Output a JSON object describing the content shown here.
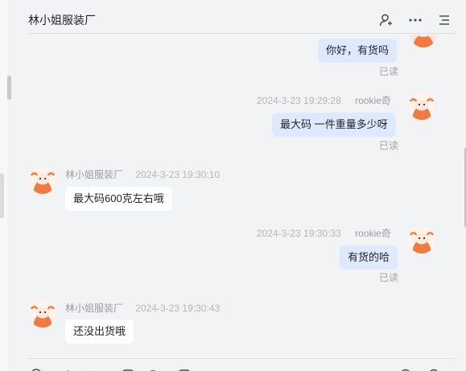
{
  "header": {
    "title": "林小姐服装厂",
    "icons": [
      "add-user-icon",
      "more-icon",
      "menu-icon"
    ]
  },
  "messages": [
    {
      "side": "me",
      "text": "你好，有货吗",
      "status": "已读"
    },
    {
      "side": "me",
      "name": "rookie奇",
      "time": "2024-3-23 19:29:28",
      "text": "最大码 一件重量多少呀",
      "status": "已读"
    },
    {
      "side": "them",
      "name": "林小姐服装厂",
      "time": "2024-3-23 19:30:10",
      "text": "最大码600克左右哦"
    },
    {
      "side": "me",
      "name": "rookie奇",
      "time": "2024-3-23 19:30:33",
      "text": "有货的哈",
      "status": "已读"
    },
    {
      "side": "them",
      "name": "林小姐服装厂",
      "time": "2024-3-23 19:30:43",
      "text": "还没出货哦"
    }
  ],
  "composer": {
    "tools": [
      "emoji-icon",
      "scissors-icon",
      "image-icon",
      "folder-icon",
      "chat-history-icon",
      "search-icon",
      "clock-icon"
    ]
  },
  "colors": {
    "my_bubble": "#dfe9fd",
    "their_bubble": "#ffffff",
    "avatar_orange": "#f07a44"
  }
}
